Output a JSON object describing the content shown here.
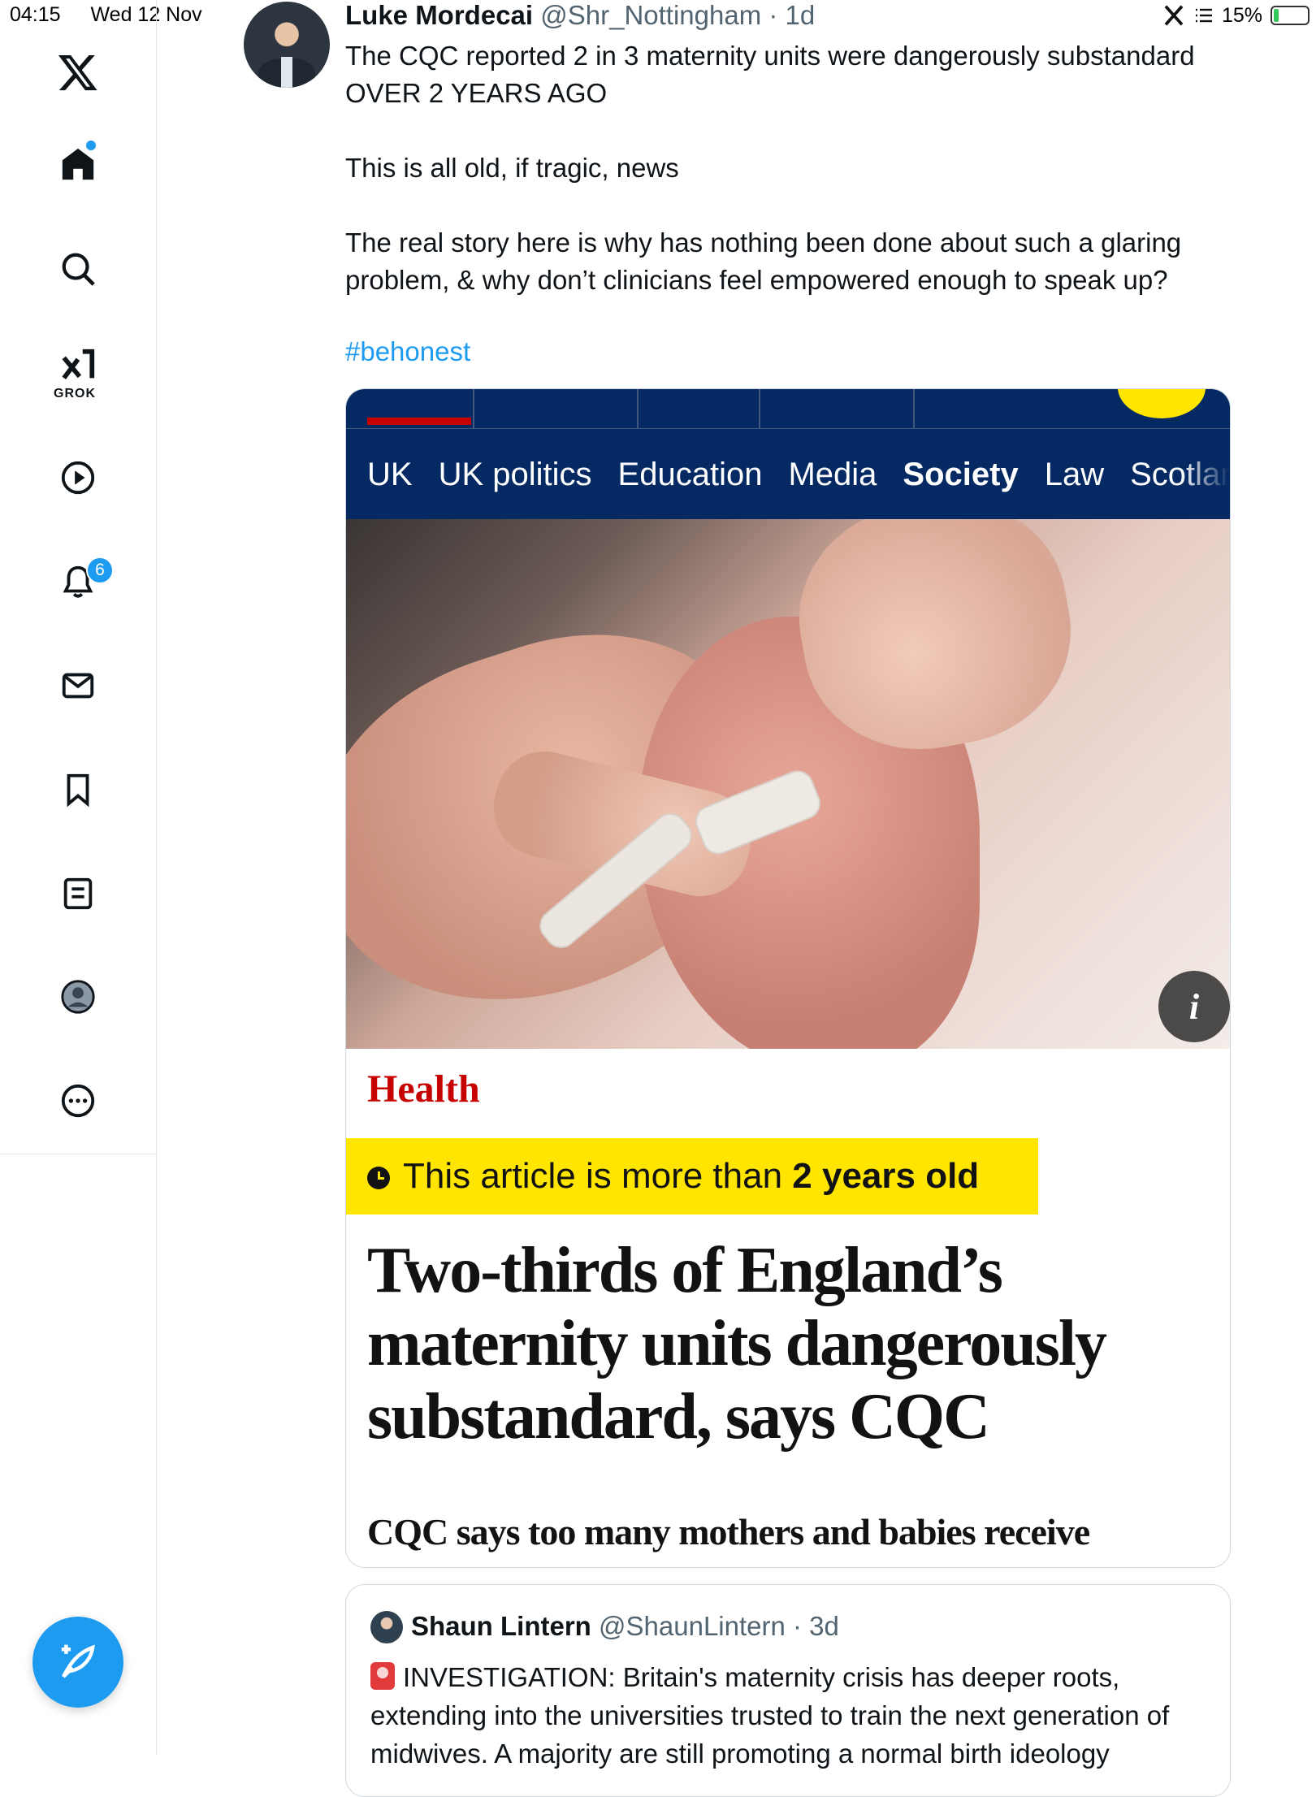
{
  "status_bar": {
    "time": "04:15",
    "date": "Wed 12 Nov",
    "battery": "15%",
    "battery_level_percent": 15
  },
  "sidebar": {
    "logo": "x-logo-icon",
    "grok_label": "GROK",
    "notification_count": "6",
    "items": [
      "home-icon",
      "search-icon",
      "grok-icon",
      "video-icon",
      "notifications-icon",
      "messages-icon",
      "bookmark-icon",
      "lists-icon",
      "profile-icon",
      "more-icon"
    ]
  },
  "tweet": {
    "author_name": "Luke Mordecai",
    "author_handle": "@Shr_Nottingham",
    "time_ago": "1d",
    "separator": " · ",
    "paragraph1": "The CQC reported 2 in 3 maternity units were dangerously substandard OVER 2 YEARS AGO",
    "paragraph2": "This is all old, if tragic, news",
    "paragraph3": "The real story here is why has nothing been done about such a glaring problem, & why don’t clinicians feel empowered enough to speak up?",
    "hashtag": "#behonest"
  },
  "embedded_article": {
    "nav_items": [
      "UK",
      "UK politics",
      "Education",
      "Media",
      "Society",
      "Law",
      "Scotland"
    ],
    "active_nav": "Society",
    "section": "Health",
    "age_notice_prefix": "This article is more than ",
    "age_notice_bold": "2 years old",
    "headline": "Two-thirds of England’s maternity units dangerously substandard, says CQC",
    "standfirst": "CQC says too many mothers and babies receive",
    "info_label": "i",
    "colors": {
      "brand_navy": "#052962",
      "accent_red": "#c70000",
      "banner_yellow": "#ffe500"
    }
  },
  "quoted_tweet": {
    "author_name": "Shaun Lintern",
    "author_handle": "@ShaunLintern",
    "time_ago": "3d",
    "separator": " · ",
    "text": "INVESTIGATION: Britain's maternity crisis has deeper roots, extending into the universities trusted to train the next generation of midwives. A majority are still promoting a normal birth ideology"
  },
  "colors": {
    "link_blue": "#1d9bf0",
    "text_primary": "#0f1419",
    "text_secondary": "#536471"
  }
}
